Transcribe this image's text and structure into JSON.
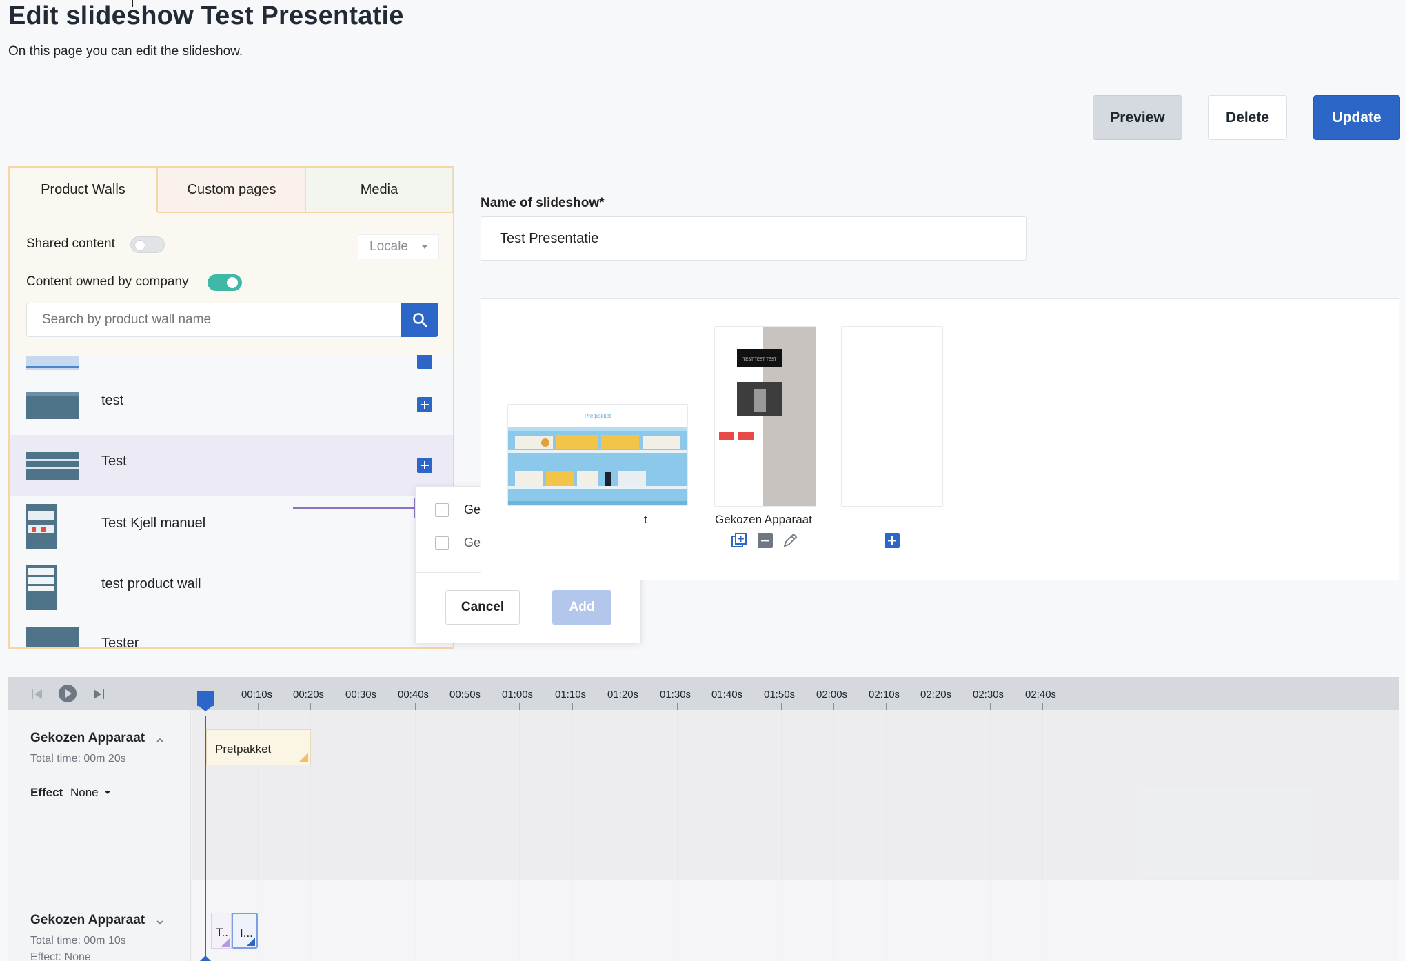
{
  "page": {
    "title": "Edit slideshow Test Presentatie",
    "subtitle": "On this page you can edit the slideshow."
  },
  "actions": {
    "preview": "Preview",
    "delete": "Delete",
    "update": "Update"
  },
  "left_panel": {
    "tabs": [
      "Product Walls",
      "Custom pages",
      "Media"
    ],
    "shared_content_label": "Shared content",
    "shared_content_on": false,
    "locale_label": "Locale",
    "owned_by_company_label": "Content owned by company",
    "owned_by_company_on": true,
    "search_placeholder": "Search by product wall name",
    "items": [
      {
        "name": ""
      },
      {
        "name": "test"
      },
      {
        "name": "Test"
      },
      {
        "name": "Test Kjell manuel"
      },
      {
        "name": "test product wall"
      },
      {
        "name": "Tester"
      }
    ]
  },
  "popup": {
    "options": [
      "Gekozen Apparaat",
      "Gekozen Apparaat"
    ],
    "cancel": "Cancel",
    "add": "Add"
  },
  "form": {
    "name_label": "Name of slideshow*",
    "name_value": "Test Presentatie"
  },
  "slides": {
    "first_label_fragment": "t",
    "first_banner": "Pretpakket",
    "second_label": "Gekozen Apparaat",
    "second_banner": "TEST TEST TEST"
  },
  "timeline": {
    "ticks": [
      "00:10s",
      "00:20s",
      "00:30s",
      "00:40s",
      "00:50s",
      "01:00s",
      "01:10s",
      "01:20s",
      "01:30s",
      "01:40s",
      "01:50s",
      "02:00s",
      "02:10s",
      "02:20s",
      "02:30s",
      "02:40s"
    ],
    "tracks": [
      {
        "title": "Gekozen Apparaat",
        "total": "Total time: 00m 20s",
        "effect_label": "Effect",
        "effect_value": "None",
        "clip": "Pretpakket"
      },
      {
        "title": "Gekozen Apparaat",
        "total": "Total time: 00m 10s",
        "effect_text": "Effect: None",
        "clips": [
          "T..",
          "I..."
        ]
      }
    ]
  },
  "colors": {
    "primary": "#2c67c8",
    "panel_border": "#f5d6a4",
    "toggle_on": "#3fb8a6",
    "arrow": "#8b74c2"
  }
}
